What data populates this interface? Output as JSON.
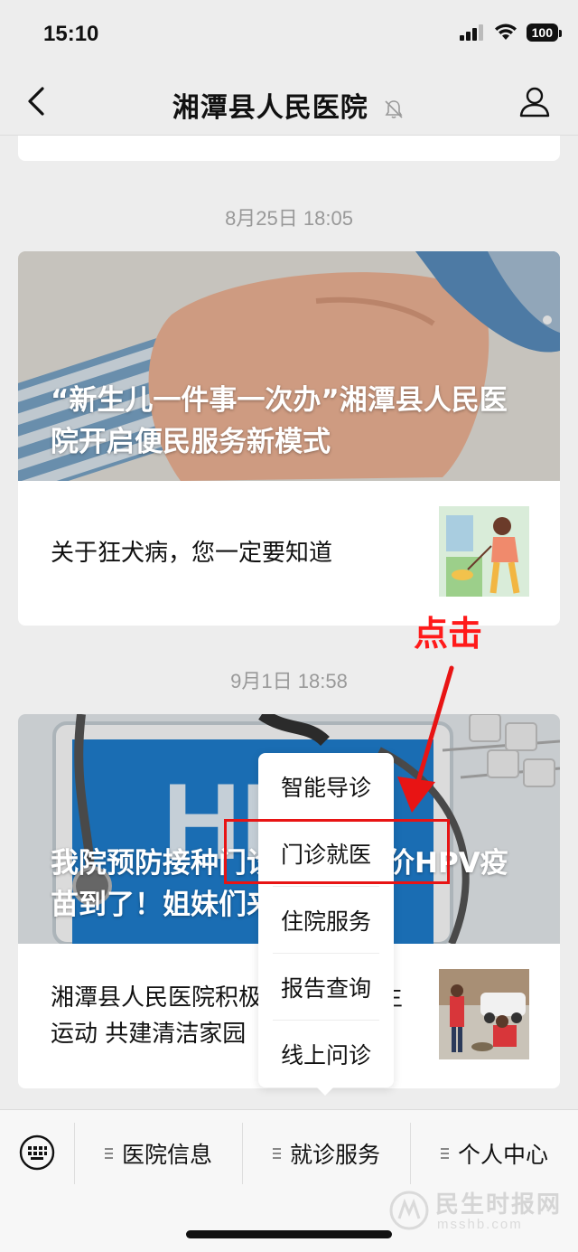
{
  "status_bar": {
    "time": "15:10",
    "battery": "100"
  },
  "nav": {
    "title": "湘潭县人民医院"
  },
  "feed": {
    "groups": [
      {
        "timestamp": "8月25日 18:05",
        "cover_title": "“新生儿一件事一次办”湘潭县人民医院开启便民服务新模式",
        "sub_title": "关于狂犬病，您一定要知道"
      },
      {
        "timestamp": "9月1日 18:58",
        "cover_title": "我院预防接种门诊二价、四价HPV疫苗到了！姐妹们来…",
        "sub_title": "湘潭县人民医院积极开展爱国卫生运动 共建清洁家园"
      }
    ]
  },
  "annotation": {
    "click_label": "点击"
  },
  "popup_menu": {
    "items": [
      {
        "label": "智能导诊"
      },
      {
        "label": "门诊就医"
      },
      {
        "label": "住院服务"
      },
      {
        "label": "报告查询"
      },
      {
        "label": "线上问诊"
      }
    ],
    "highlighted": "门诊就医"
  },
  "bottom_menu": {
    "items": [
      {
        "label": "医院信息"
      },
      {
        "label": "就诊服务"
      },
      {
        "label": "个人中心"
      }
    ]
  },
  "watermark": {
    "text": "民生时报网",
    "sub": "msshb.com"
  },
  "colors": {
    "annotation_red": "#e81414",
    "background": "#ededed"
  }
}
